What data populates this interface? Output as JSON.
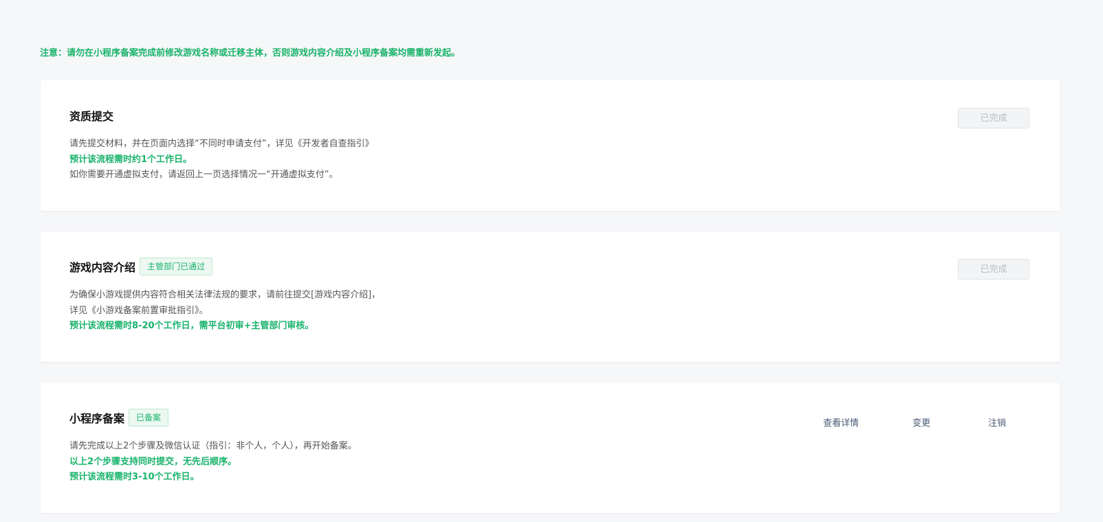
{
  "notice": "注意：请勿在小程序备案完成前修改游戏名称或迁移主体，否则游戏内容介绍及小程序备案均需重新发起。",
  "cards": [
    {
      "title": "资质提交",
      "badge": "",
      "lines": [
        "请先提交材料，并在页面内选择“不同时申请支付”，详见《开发者自查指引》",
        "预计该流程需时约1个工作日。",
        "如你需要开通虚拟支付，请返回上一页选择情况一“开通虚拟支付”。"
      ],
      "button": "已完成"
    },
    {
      "title": "游戏内容介绍",
      "badge": "主管部门已通过",
      "lines": [
        "为确保小游戏提供内容符合相关法律法规的要求，请前往提交[游戏内容介绍]，",
        "详见《小游戏备案前置审批指引》。",
        "预计该流程需时8-20个工作日，需平台初审+主管部门审核。"
      ],
      "button": "已完成"
    },
    {
      "title": "小程序备案",
      "badge": "已备案",
      "lines": [
        "请先完成以上2个步骤及微信认证（指引：非个人，个人），再开始备案。",
        "以上2个步骤支持同时提交，无先后顺序。",
        "预计该流程需时3-10个工作日。"
      ],
      "actions": {
        "detail": "查看详情",
        "change": "变更",
        "cancel": "注销"
      }
    }
  ],
  "colors": {
    "accent_green": "#19b36b",
    "badge_bg": "#ecf8f1",
    "link": "#4a5a75"
  }
}
